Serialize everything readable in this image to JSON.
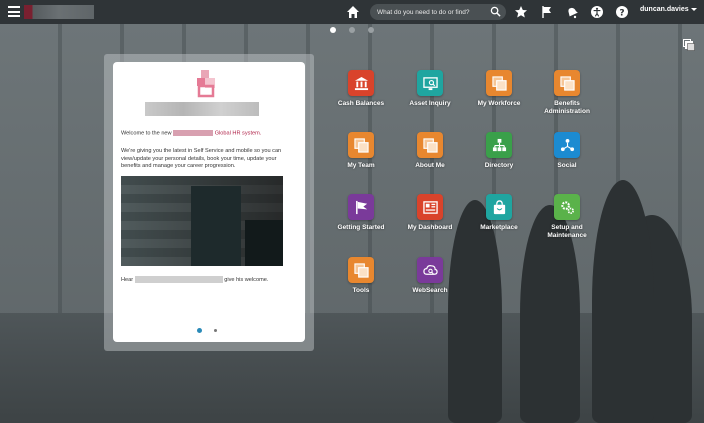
{
  "topbar": {
    "search_placeholder": "What do you need to do or find?",
    "user_name": "duncan.davies"
  },
  "pager": {
    "pages": 3,
    "active": 1
  },
  "welcome_card": {
    "welcome_prefix": "Welcome to the new",
    "welcome_suffix": "Global HR system.",
    "intro": "We're giving you the latest in Self Service and mobile so you can view/update your personal details, book your time, update your benefits and manage your career progression.",
    "hear_prefix": "Hear",
    "hear_suffix": "give his welcome."
  },
  "tiles": [
    {
      "label": "Cash Balances",
      "color": "#d9432b",
      "icon": "bank-icon"
    },
    {
      "label": "Asset Inquiry",
      "color": "#1fa5a0",
      "icon": "asset-inquiry-icon"
    },
    {
      "label": "My Workforce",
      "color": "#e8872f",
      "icon": "documents-icon"
    },
    {
      "label": "Benefits Administration",
      "color": "#e8872f",
      "icon": "documents-icon"
    },
    {
      "label": "My Team",
      "color": "#e8872f",
      "icon": "documents-icon"
    },
    {
      "label": "About Me",
      "color": "#e8872f",
      "icon": "documents-icon"
    },
    {
      "label": "Directory",
      "color": "#3aa04a",
      "icon": "org-chart-icon"
    },
    {
      "label": "Social",
      "color": "#1c8bd1",
      "icon": "social-network-icon"
    },
    {
      "label": "Getting Started",
      "color": "#7a3a9a",
      "icon": "flag-icon"
    },
    {
      "label": "My Dashboard",
      "color": "#d9432b",
      "icon": "dashboard-icon"
    },
    {
      "label": "Marketplace",
      "color": "#1fa5a0",
      "icon": "shopping-bag-icon"
    },
    {
      "label": "Setup and Maintenance",
      "color": "#5ab24a",
      "icon": "gears-icon"
    },
    {
      "label": "Tools",
      "color": "#e8872f",
      "icon": "documents-icon"
    },
    {
      "label": "WebSearch",
      "color": "#7a3a9a",
      "icon": "web-search-icon"
    }
  ]
}
